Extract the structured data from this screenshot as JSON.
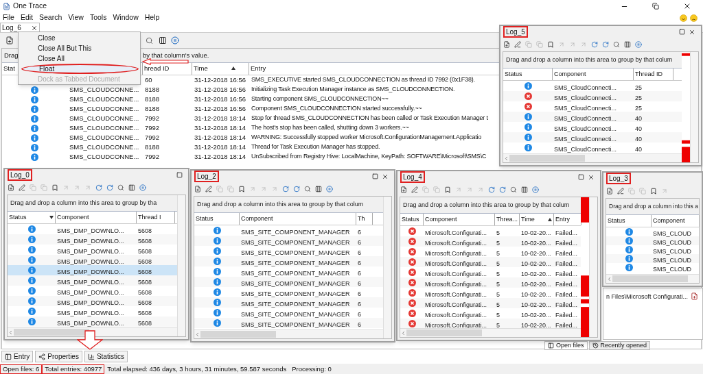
{
  "window": {
    "title": "One Trace"
  },
  "menu": [
    "File",
    "Edit",
    "Search",
    "View",
    "Tools",
    "Window",
    "Help"
  ],
  "document_tabs": [
    {
      "label": "Log_6",
      "selected": true
    }
  ],
  "context_menu": [
    {
      "label": "Close",
      "disabled": false,
      "highlighted": false
    },
    {
      "label": "Close All But This",
      "disabled": false,
      "highlighted": false
    },
    {
      "label": "Close All",
      "disabled": false,
      "highlighted": false
    },
    {
      "label": "Float",
      "disabled": false,
      "highlighted": true
    },
    {
      "label": "Dock as Tabbed Document",
      "disabled": true,
      "highlighted": false
    }
  ],
  "main_log": {
    "group_hint": [
      "Drag",
      "by that column's value."
    ],
    "columns": [
      {
        "label": "Stat",
        "sorted": false
      },
      {
        "label": "hread ID",
        "sorted": false
      },
      {
        "label": "Time",
        "sorted": true
      },
      {
        "label": "Entry",
        "sorted": false
      }
    ],
    "rows": [
      {
        "thread": "60",
        "time": "31-12-2018 16:56",
        "entry": "SMS_EXECUTIVE started SMS_CLOUDCONNECTION as thread ID 7992 (0x1F38)."
      },
      {
        "kind": "info",
        "component": "SMS_CLOUDCONNE...",
        "thread": "8188",
        "time": "31-12-2018 16:56",
        "entry": "Initializing Task Execution Manager instance as SMS_CLOUDCONNECTION."
      },
      {
        "kind": "info",
        "component": "SMS_CLOUDCONNE...",
        "thread": "8188",
        "time": "31-12-2018 16:56",
        "entry": "Starting component SMS_CLOUDCONNECTION~~"
      },
      {
        "kind": "info",
        "component": "SMS_CLOUDCONNE...",
        "thread": "8188",
        "time": "31-12-2018 16:56",
        "entry": "Component SMS_CLOUDCONNECTION started successfully.~~"
      },
      {
        "kind": "info",
        "component": "SMS_CLOUDCONNE...",
        "thread": "7992",
        "time": "31-12-2018 18:14",
        "entry": "Stop for thread SMS_CLOUDCONNECTION has been called or Task Execution Manager t"
      },
      {
        "kind": "info",
        "component": "SMS_CLOUDCONNE...",
        "thread": "7992",
        "time": "31-12-2018 18:14",
        "entry": "The host's stop has been called, shutting down 3 workers.~~"
      },
      {
        "kind": "info",
        "component": "SMS_CLOUDCONNE...",
        "thread": "7992",
        "time": "31-12-2018 18:14",
        "entry": "WARNING: Successfully stopped worker Microsoft.ConfigurationManagement.Applicatio"
      },
      {
        "kind": "info",
        "component": "SMS_CLOUDCONNE...",
        "thread": "8188",
        "time": "31-12-2018 18:14",
        "entry": "Thread for Task Execution Manager has stopped."
      },
      {
        "kind": "info",
        "component": "SMS_CLOUDCONNE...",
        "thread": "7992",
        "time": "31-12-2018 18:14",
        "entry": "UnSubscribed from Registry Hive: LocalMachine, KeyPath: SOFTWARE\\Microsoft\\SMS\\C"
      }
    ]
  },
  "floating_windows": [
    {
      "title": "Log_5",
      "highlighted": true,
      "closable": true,
      "error_map": true,
      "group_hint": "Drag and drop a column into this area to group by that colum",
      "status_column": {
        "label": "Status",
        "sorted": false
      },
      "columns": [
        {
          "label": "Component",
          "sorted": false
        },
        {
          "label": "Thread ID",
          "sorted": false
        }
      ],
      "rows": [
        {
          "kind": "info",
          "cells": [
            "SMS_CloudConnecti...",
            "25"
          ],
          "selected": false
        },
        {
          "kind": "error",
          "cells": [
            "SMS_CloudConnecti...",
            "25"
          ],
          "selected": false
        },
        {
          "kind": "error",
          "cells": [
            "SMS_CloudConnecti...",
            "25"
          ],
          "selected": false
        },
        {
          "kind": "info",
          "cells": [
            "SMS_CloudConnecti...",
            "40"
          ],
          "selected": false
        },
        {
          "kind": "info",
          "cells": [
            "SMS_CloudConnecti...",
            "40"
          ],
          "selected": false
        },
        {
          "kind": "info",
          "cells": [
            "SMS_CloudConnecti...",
            "40"
          ],
          "selected": false
        },
        {
          "kind": "info",
          "cells": [
            "SMS_CloudConnecti...",
            "40"
          ],
          "selected": false
        }
      ]
    },
    {
      "title": "Log_0",
      "highlighted": true,
      "closable": false,
      "error_map": false,
      "group_hint": "Drag and drop a column into this area to group by tha",
      "status_column": {
        "label": "Status",
        "sorted": true
      },
      "columns": [
        {
          "label": "Component",
          "sorted": false
        },
        {
          "label": "Thread I",
          "sorted": false
        }
      ],
      "rows": [
        {
          "kind": "info",
          "cells": [
            "SMS_DMP_DOWNLO...",
            "5608"
          ],
          "selected": false
        },
        {
          "kind": "info",
          "cells": [
            "SMS_DMP_DOWNLO...",
            "5608"
          ],
          "selected": false
        },
        {
          "kind": "info",
          "cells": [
            "SMS_DMP_DOWNLO...",
            "5608"
          ],
          "selected": false
        },
        {
          "kind": "info",
          "cells": [
            "SMS_DMP_DOWNLO...",
            "5608"
          ],
          "selected": false
        },
        {
          "kind": "info",
          "cells": [
            "SMS_DMP_DOWNLO...",
            "5608"
          ],
          "selected": true
        },
        {
          "kind": "info",
          "cells": [
            "SMS_DMP_DOWNLO...",
            "5608"
          ],
          "selected": false
        },
        {
          "kind": "info",
          "cells": [
            "SMS_DMP_DOWNLO...",
            "5608"
          ],
          "selected": false
        },
        {
          "kind": "info",
          "cells": [
            "SMS_DMP_DOWNLO...",
            "5608"
          ],
          "selected": false
        },
        {
          "kind": "info",
          "cells": [
            "SMS_DMP_DOWNLO...",
            "5608"
          ],
          "selected": false
        },
        {
          "kind": "info",
          "cells": [
            "SMS_DMP_DOWNLO...",
            "5608"
          ],
          "selected": false
        }
      ]
    },
    {
      "title": "Log_2",
      "highlighted": true,
      "closable": true,
      "error_map": false,
      "group_hint": "Drag and drop a column into this area to group by that colum",
      "status_column": {
        "label": "Status",
        "sorted": false
      },
      "columns": [
        {
          "label": "Component",
          "sorted": false
        },
        {
          "label": "Th",
          "sorted": false
        }
      ],
      "rows": [
        {
          "kind": "info",
          "cells": [
            "SMS_SITE_COMPONENT_MANAGER",
            "6"
          ],
          "selected": false
        },
        {
          "kind": "info",
          "cells": [
            "SMS_SITE_COMPONENT_MANAGER",
            "6"
          ],
          "selected": false
        },
        {
          "kind": "info",
          "cells": [
            "SMS_SITE_COMPONENT_MANAGER",
            "6"
          ],
          "selected": false
        },
        {
          "kind": "info",
          "cells": [
            "SMS_SITE_COMPONENT_MANAGER",
            "6"
          ],
          "selected": false
        },
        {
          "kind": "info",
          "cells": [
            "SMS_SITE_COMPONENT_MANAGER",
            "6"
          ],
          "selected": false
        },
        {
          "kind": "info",
          "cells": [
            "SMS_SITE_COMPONENT_MANAGER",
            "6"
          ],
          "selected": false
        },
        {
          "kind": "info",
          "cells": [
            "SMS_SITE_COMPONENT_MANAGER",
            "6"
          ],
          "selected": false
        },
        {
          "kind": "info",
          "cells": [
            "SMS_SITE_COMPONENT_MANAGER",
            "6"
          ],
          "selected": false
        },
        {
          "kind": "info",
          "cells": [
            "SMS_SITE_COMPONENT_MANAGER",
            "6"
          ],
          "selected": false
        },
        {
          "kind": "info",
          "cells": [
            "SMS_SITE_COMPONENT_MANAGER",
            "6"
          ],
          "selected": false
        }
      ]
    },
    {
      "title": "Log_4",
      "highlighted": true,
      "closable": true,
      "error_map": true,
      "group_hint": "Drag and drop a column into this area to group by that colum",
      "status_column": {
        "label": "Status",
        "sorted": false
      },
      "columns": [
        {
          "label": "Component",
          "sorted": false
        },
        {
          "label": "Threa...",
          "sorted": false
        },
        {
          "label": "Time",
          "sorted": true
        },
        {
          "label": "Entry",
          "sorted": false
        }
      ],
      "rows": [
        {
          "kind": "error",
          "cells": [
            "Microsoft.Configurati...",
            "5",
            "10-02-20...",
            "Failed..."
          ],
          "selected": false
        },
        {
          "kind": "error",
          "cells": [
            "Microsoft.Configurati...",
            "5",
            "10-02-20...",
            "Failed..."
          ],
          "selected": false
        },
        {
          "kind": "error",
          "cells": [
            "Microsoft.Configurati...",
            "5",
            "10-02-20...",
            "Failed..."
          ],
          "selected": false
        },
        {
          "kind": "error",
          "cells": [
            "Microsoft.Configurati...",
            "5",
            "10-02-20...",
            "Failed..."
          ],
          "selected": false
        },
        {
          "kind": "error",
          "cells": [
            "Microsoft.Configurati...",
            "5",
            "10-02-20...",
            "Failed..."
          ],
          "selected": false
        },
        {
          "kind": "error",
          "cells": [
            "Microsoft.Configurati...",
            "5",
            "10-02-20...",
            "Failed..."
          ],
          "selected": false
        },
        {
          "kind": "error",
          "cells": [
            "Microsoft.Configurati...",
            "5",
            "10-02-20...",
            "Failed..."
          ],
          "selected": false
        },
        {
          "kind": "error",
          "cells": [
            "Microsoft.Configurati...",
            "5",
            "10-02-20...",
            "Failed..."
          ],
          "selected": false
        },
        {
          "kind": "error",
          "cells": [
            "Microsoft.Configurati...",
            "5",
            "10-02-20...",
            "Failed..."
          ],
          "selected": false
        },
        {
          "kind": "error",
          "cells": [
            "Microsoft.Configurati...",
            "5",
            "10-02-20...",
            "Failed..."
          ],
          "selected": false
        }
      ]
    },
    {
      "title": "Log_3",
      "highlighted": true,
      "closable": false,
      "error_map": false,
      "group_hint": "Drag and drop a column into this a",
      "status_column": {
        "label": "Status",
        "sorted": false
      },
      "columns": [
        {
          "label": "Component",
          "sorted": false
        }
      ],
      "rows": [
        {
          "kind": "info",
          "cells": [
            "SMS_CLOUD"
          ],
          "selected": false
        },
        {
          "kind": "info",
          "cells": [
            "SMS_CLOUD"
          ],
          "selected": false
        },
        {
          "kind": "info",
          "cells": [
            "SMS_CLOUD"
          ],
          "selected": false
        },
        {
          "kind": "info",
          "cells": [
            "SMS_CLOUD"
          ],
          "selected": false
        },
        {
          "kind": "info",
          "cells": [
            "SMS_CLOUD"
          ],
          "selected": false
        }
      ]
    }
  ],
  "files_pane": {
    "path": "n Files\\Microsoft Configurati...",
    "tabs": [
      {
        "label": "Open files",
        "selected": true
      },
      {
        "label": "Recently opened",
        "selected": false
      }
    ]
  },
  "tool_tabs": [
    {
      "label": "Entry"
    },
    {
      "label": "Properties"
    },
    {
      "label": "Statistics"
    }
  ],
  "status_bar": [
    {
      "text": "Open files: 6",
      "highlighted": true
    },
    {
      "text": "Total entries: 40977",
      "highlighted": true
    },
    {
      "text": "Total elapsed: 436 days, 3 hours, 31 minutes, 59.587 seconds",
      "highlighted": false
    },
    {
      "text": "Processing: 0",
      "highlighted": false
    }
  ]
}
